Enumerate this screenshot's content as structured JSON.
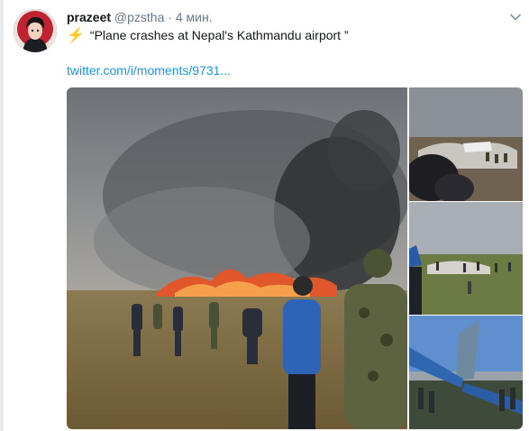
{
  "tweet": {
    "display_name": "prazeet",
    "handle": "@pzstha",
    "separator": "·",
    "time": "4 мин.",
    "bolt": "⚡",
    "text": "“Plane crashes at Nepal's Kathmandu airport ”",
    "link": "twitter.com/i/moments/9731..."
  },
  "icons": {
    "caret": "chevron-down-icon",
    "bolt": "lightning-icon"
  },
  "colors": {
    "link": "#1b95e0",
    "secondary_text": "#657786",
    "primary_text": "#14171a",
    "bolt": "#f5b400"
  }
}
